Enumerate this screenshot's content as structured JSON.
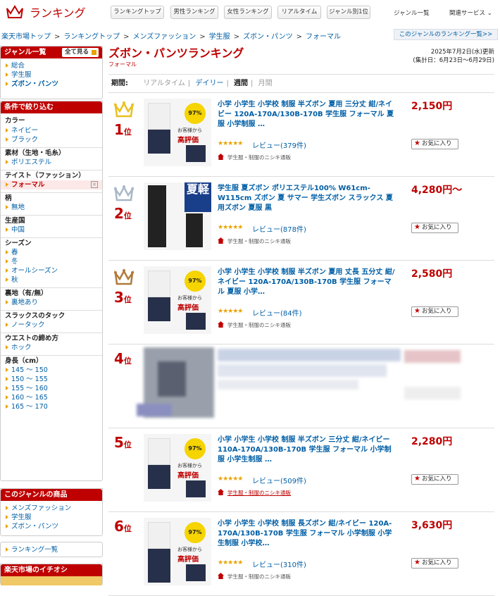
{
  "header": {
    "logo_text": "ランキング",
    "nav": [
      "ランキングトップ",
      "男性ランキング",
      "女性ランキング",
      "リアルタイム",
      "ジャンル別1位"
    ],
    "links": [
      "ジャンル一覧",
      "関連サービス"
    ]
  },
  "breadcrumb": [
    "楽天市場トップ",
    "ランキングトップ",
    "メンズファッション",
    "学生服",
    "ズボン・パンツ",
    "フォーマル"
  ],
  "genre_ranking_link": "このジャンルのランキング一覧>>",
  "page": {
    "title": "ズボン・パンツランキング",
    "subtitle": "フォーマル",
    "updated": "2025年7月2日(水)更新",
    "period_range": "(集計日：6月23日～6月29日)"
  },
  "period": {
    "label": "期間:",
    "options": [
      "リアルタイム",
      "デイリー",
      "週間",
      "月間"
    ]
  },
  "sidebar": {
    "genre_head": "ジャンル一覧",
    "all_btn": "全て見る",
    "genres": [
      "総合",
      "学生服",
      "ズボン・パンツ"
    ],
    "filter_head": "条件で絞り込む",
    "filters": [
      {
        "name": "カラー",
        "items": [
          "ネイビー",
          "ブラック"
        ]
      },
      {
        "name": "素材（生地・毛糸）",
        "items": [
          "ポリエステル"
        ]
      },
      {
        "name": "テイスト（ファッション）",
        "items": [
          "フォーマル"
        ]
      },
      {
        "name": "柄",
        "items": [
          "無地"
        ]
      },
      {
        "name": "生産国",
        "items": [
          "中国"
        ]
      },
      {
        "name": "シーズン",
        "items": [
          "春",
          "冬",
          "オールシーズン",
          "秋"
        ]
      },
      {
        "name": "裏地（有/無）",
        "items": [
          "裏地あり"
        ]
      },
      {
        "name": "スラックスのタック",
        "items": [
          "ノータック"
        ]
      },
      {
        "name": "ウエストの締め方",
        "items": [
          "ホック"
        ]
      },
      {
        "name": "身長（cm）",
        "items": [
          "145 ～ 150",
          "150 ～ 155",
          "155 ～ 160",
          "160 ～ 165",
          "165 ～ 170"
        ]
      }
    ],
    "products_head": "このジャンルの商品",
    "products": [
      "メンズファッション",
      "学生服",
      "ズボン・パンツ"
    ],
    "ranking_list": "ランキング一覧",
    "recommend_head": "楽天市場のイチオシ"
  },
  "items": [
    {
      "rank": "1",
      "suffix": "位",
      "title": "小学 小学生 小学校 制服 半ズボン 夏用 三分丈 紺/ネイビー 120A-170A/130B-170B 学生服 フォーマル 夏服 小学制服 …",
      "stars": "★★★★★",
      "reviews": "レビュー(379件)",
      "shop": "学生服・制服のニシキ通販",
      "price": "2,150円",
      "fav": "お気に入り"
    },
    {
      "rank": "2",
      "suffix": "位",
      "title": "学生服 夏ズボン ポリエステル100% W61cm-W115cm ズボン 夏 サマー 学生ズボン スラックス 夏用ズボン 夏服 黒",
      "stars": "★★★★★",
      "reviews": "レビュー(878件)",
      "shop": "学生服・制服のニシキ通販",
      "price": "4,280円～",
      "fav": "お気に入り"
    },
    {
      "rank": "3",
      "suffix": "位",
      "title": "小学 小学生 小学校 制服 半ズボン 夏用 丈長 五分丈 紺/ネイビー 120A-170A/130B-170B 学生服 フォーマル 夏服 小学…",
      "stars": "★★★★★",
      "reviews": "レビュー(84件)",
      "shop": "学生服・制服のニシキ通販",
      "price": "2,580円",
      "fav": "お気に入り"
    },
    {
      "rank": "4",
      "suffix": "位"
    },
    {
      "rank": "5",
      "suffix": "位",
      "title": "小学 小学生 小学校 制服 半ズボン 三分丈 紺/ネイビー 110A-170A/130B-170B 学生服 フォーマル 小学制服 小学生制服 …",
      "stars": "★★★★★",
      "reviews": "レビュー(509件)",
      "shop": "学生服・制服のニシキ通販",
      "price": "2,280円",
      "fav": "お気に入り"
    },
    {
      "rank": "6",
      "suffix": "位",
      "title": "小学 小学生 小学校 制服 長ズボン 紺/ネイビー 120A-170A/130B-170B 学生服 フォーマル 小学制服 小学生制服 小学校…",
      "stars": "★★★★★",
      "reviews": "レビュー(310件)",
      "shop": "学生服・制服のニシキ通販",
      "price": "3,630円",
      "fav": "お気に入り"
    }
  ],
  "thumb_badge": {
    "pct": "97%",
    "line1": "お客様から",
    "line2": "高評価",
    "season1": "夏",
    "season2": "軽"
  },
  "colors": {
    "accent": "#bf0000",
    "link": "#005ea5",
    "gold": "#e8a300"
  }
}
